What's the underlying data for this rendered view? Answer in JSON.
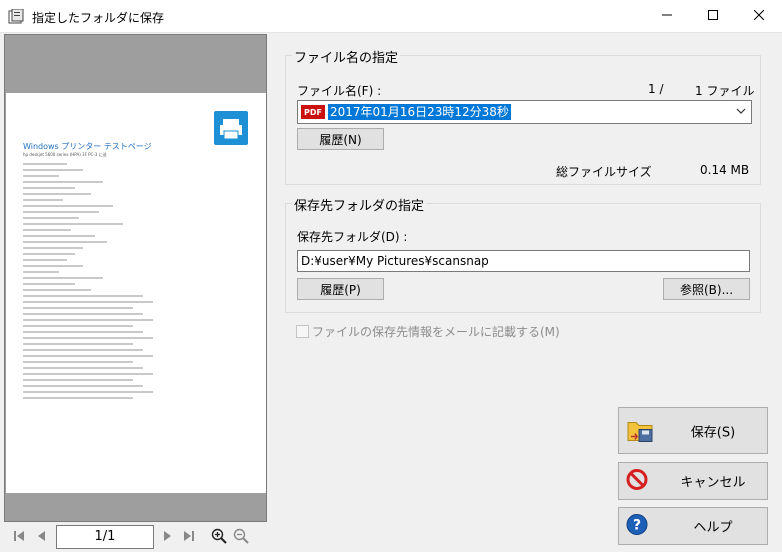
{
  "window": {
    "title": "指定したフォルダに保存"
  },
  "preview": {
    "page_indicator": "1/1",
    "doc_title": "Windows プリンター テストページ",
    "doc_subtitle": "hp deskjet 5600 series (HPA) 3F PC-3 に送",
    "line_count": 40
  },
  "filename_group": {
    "legend": "ファイル名の指定",
    "label": "ファイル名(F) :",
    "index_current": "1 /",
    "index_total": "1 ファイル",
    "badge": "PDF",
    "selected_file": "2017年01月16日23時12分38秒",
    "history_button": "履歴(N)",
    "total_size_label": "総ファイルサイズ",
    "total_size_value": "0.14 MB"
  },
  "folder_group": {
    "legend": "保存先フォルダの指定",
    "label": "保存先フォルダ(D) :",
    "path_value": "D:¥user¥My Pictures¥scansnap",
    "history_button": "履歴(P)",
    "browse_button": "参照(B)..."
  },
  "email_checkbox": {
    "label": "ファイルの保存先情報をメールに記載する(M)",
    "checked": false
  },
  "actions": {
    "save": "保存(S)",
    "cancel": "キャンセル",
    "help": "ヘルプ"
  }
}
